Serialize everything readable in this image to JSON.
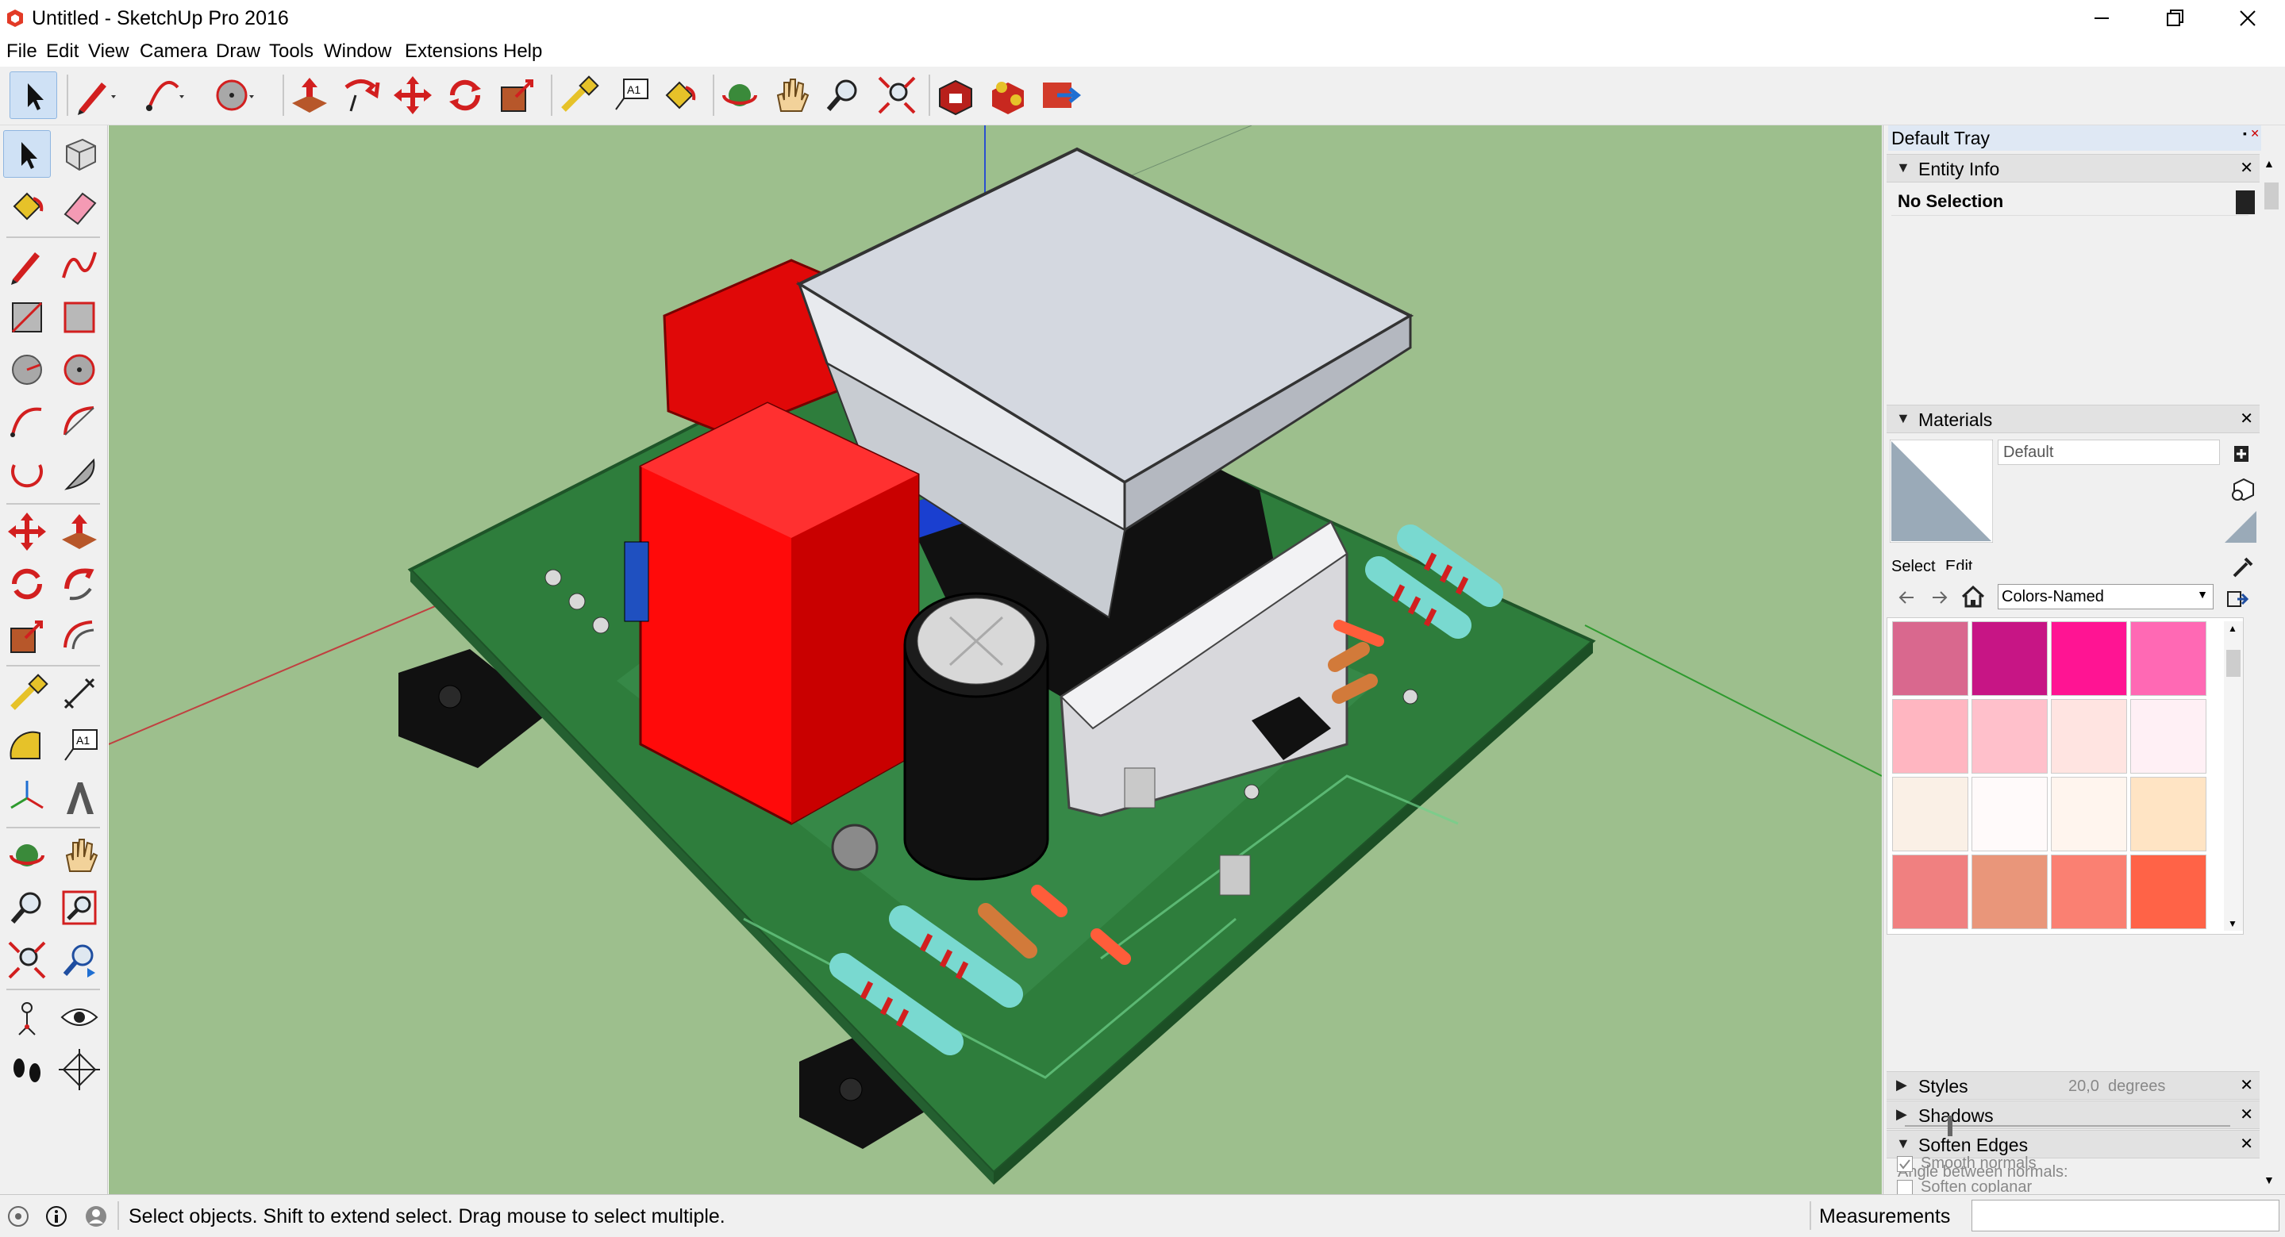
{
  "window": {
    "title": "Untitled - SketchUp Pro 2016",
    "controls": [
      "minimize-icon",
      "restore-icon",
      "close-icon"
    ]
  },
  "menu": [
    "File",
    "Edit",
    "View",
    "Camera",
    "Draw",
    "Tools",
    "Window",
    "Extensions",
    "Help"
  ],
  "tray": {
    "title": "Default Tray",
    "entity_info": {
      "header": "Entity Info",
      "selection": "No Selection"
    },
    "materials": {
      "header": "Materials",
      "current": "Default",
      "tab_select": "Select",
      "tab_edit": "Edit",
      "library": "Colors-Named",
      "swatches": [
        "#d9688e",
        "#c71585",
        "#ff1493",
        "#ff69b4",
        "#ffb6c1",
        "#ffc0cb",
        "#ffe4e1",
        "#fff0f5",
        "#faf0e6",
        "#fffafa",
        "#fff5ee",
        "#ffe4c4",
        "#f08080",
        "#e9967a",
        "#fa8072",
        "#ff6347"
      ]
    },
    "styles_header": "Styles",
    "shadows_header": "Shadows",
    "soften_edges": {
      "header": "Soften Edges",
      "angle_label": "Angle between normals:",
      "angle_value": "20,0  degrees",
      "smooth_normals": "Smooth normals",
      "soften_coplanar": "Soften coplanar"
    }
  },
  "status": {
    "hint": "Select objects. Shift to extend select. Drag mouse to select multiple.",
    "measurements_label": "Measurements"
  },
  "colors": {
    "viewport_bg": "#9dbf8d",
    "pcb": "#2e7d3c",
    "relay_red": "#ff0a0a",
    "select_highlight": "#cfe1f5"
  }
}
